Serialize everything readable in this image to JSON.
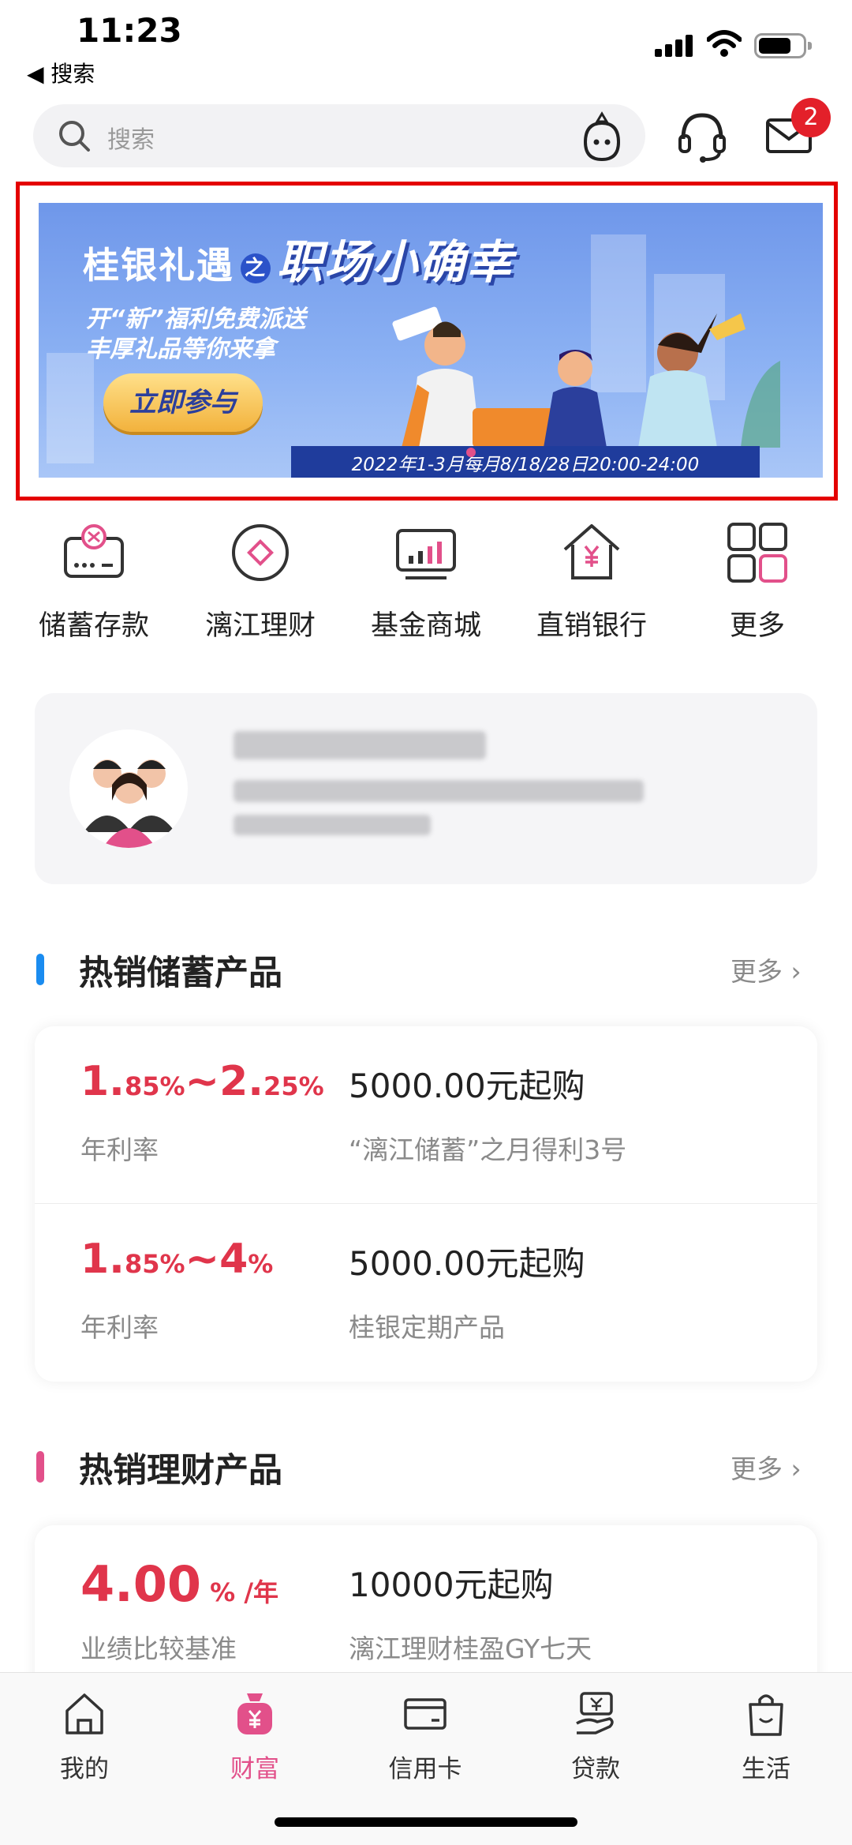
{
  "status_bar": {
    "time": "11:23",
    "back_label": "◀ 搜索"
  },
  "search": {
    "placeholder": "搜索"
  },
  "header": {
    "mail_badge_count": "2"
  },
  "banner": {
    "title_left": "桂银礼遇",
    "title_connector": "之",
    "title_right": "职场小确幸",
    "subtitle_line1": "开“新”福利免费派送",
    "subtitle_line2": "丰厚礼品等你来拿",
    "cta_label": "立即参与",
    "date_text": "2022年1-3月每月8/18/28日20:00-24:00"
  },
  "quick_menu": [
    {
      "label": "储蓄存款",
      "icon": "savings-deposit-icon"
    },
    {
      "label": "漓江理财",
      "icon": "lijiang-wealth-icon"
    },
    {
      "label": "基金商城",
      "icon": "fund-mall-icon"
    },
    {
      "label": "直销银行",
      "icon": "direct-bank-icon"
    },
    {
      "label": "更多",
      "icon": "more-grid-icon"
    }
  ],
  "savings_section": {
    "title": "热销储蓄产品",
    "more_label": "更多",
    "accent_color": "#1a8cf0",
    "products": [
      {
        "rate_a_int": "1.",
        "rate_a_dec": "85%",
        "rate_sep": "~",
        "rate_b_int": "2.",
        "rate_b_dec": "25%",
        "rate_label": "年利率",
        "amount": "5000.00元起购",
        "name": "“漓江储蓄”之月得利3号"
      },
      {
        "rate_a_int": "1.",
        "rate_a_dec": "85%",
        "rate_sep": "~",
        "rate_b_int": "4",
        "rate_b_dec": "%",
        "rate_label": "年利率",
        "amount": "5000.00元起购",
        "name": "桂银定期产品"
      }
    ]
  },
  "wealth_section": {
    "title": "热销理财产品",
    "more_label": "更多",
    "accent_color": "#e2508a",
    "products": [
      {
        "rate_value": "4.00",
        "rate_unit": " % /年",
        "rate_label": "业绩比较基准",
        "amount": "10000元起购",
        "name": "漓江理财桂盈GY七天"
      }
    ]
  },
  "tab_bar": [
    {
      "label": "我的",
      "icon": "home-icon",
      "active": false
    },
    {
      "label": "财富",
      "icon": "wealth-bag-icon",
      "active": true
    },
    {
      "label": "信用卡",
      "icon": "credit-card-icon",
      "active": false
    },
    {
      "label": "贷款",
      "icon": "loan-icon",
      "active": false
    },
    {
      "label": "生活",
      "icon": "shopping-bag-icon",
      "active": false
    }
  ],
  "colors": {
    "brand_pink": "#e2508a",
    "rate_red": "#e0354b",
    "badge_red": "#e3202a"
  }
}
